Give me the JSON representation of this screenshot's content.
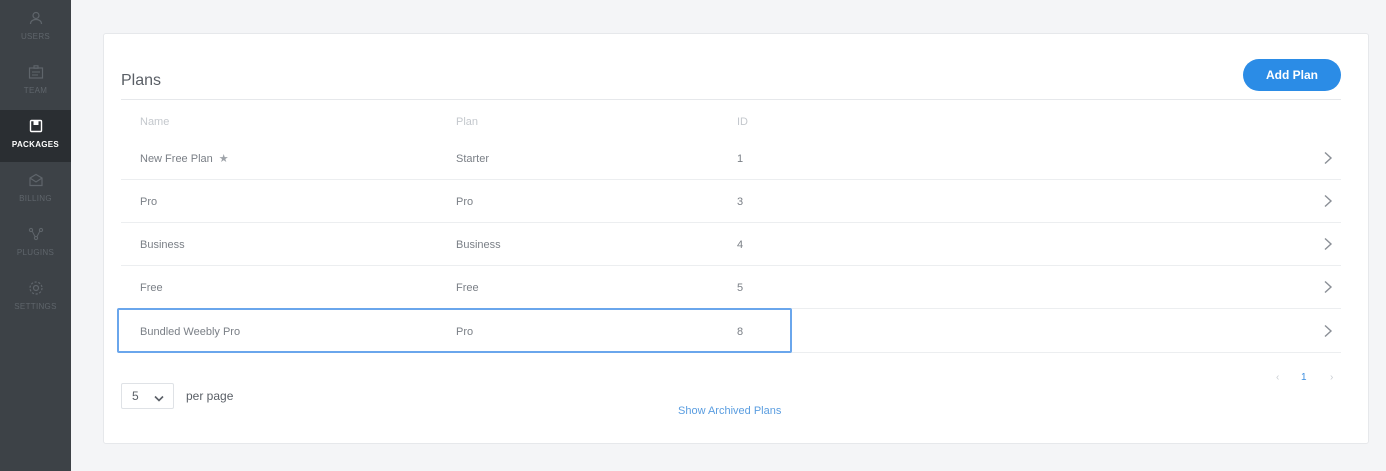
{
  "sidebar": {
    "items": [
      {
        "label": "USERS",
        "icon": "user-icon"
      },
      {
        "label": "TEAM",
        "icon": "team-icon"
      },
      {
        "label": "PACKAGES",
        "icon": "package-icon",
        "active": true
      },
      {
        "label": "BILLING",
        "icon": "billing-icon"
      },
      {
        "label": "PLUGINS",
        "icon": "plugins-icon"
      },
      {
        "label": "SETTINGS",
        "icon": "gear-icon"
      }
    ]
  },
  "plans": {
    "title": "Plans",
    "add_button": "Add Plan",
    "columns": [
      "Name",
      "Plan",
      "ID"
    ],
    "rows": [
      {
        "name": "New Free Plan",
        "star": "★",
        "plan": "Starter",
        "id": "1"
      },
      {
        "name": "Pro",
        "star": "",
        "plan": "Pro",
        "id": "3"
      },
      {
        "name": "Business",
        "star": "",
        "plan": "Business",
        "id": "4"
      },
      {
        "name": "Free",
        "star": "",
        "plan": "Free",
        "id": "5"
      },
      {
        "name": "Bundled Weebly Pro",
        "star": "",
        "plan": "Pro",
        "id": "8",
        "highlighted": true
      }
    ],
    "per_page_value": "5",
    "per_page_label": "per page",
    "show_archived": "Show Archived Plans",
    "pagination": {
      "prev": "‹",
      "current": "1",
      "next": "›"
    }
  },
  "colors": {
    "sidebar_bg": "#3d4247",
    "accent": "#2b8ce6",
    "highlight_border": "#6aa6ec"
  }
}
